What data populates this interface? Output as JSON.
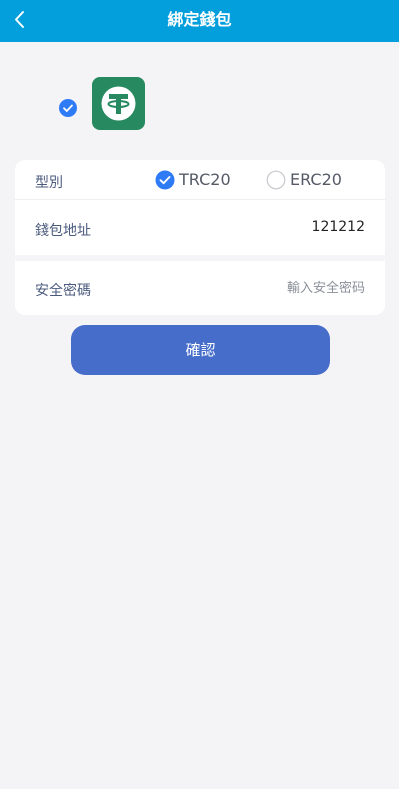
{
  "header": {
    "title": "綁定錢包",
    "back_icon": "chevron-left-icon",
    "background_color": "#039fdc"
  },
  "coin": {
    "selected": true,
    "logo_icon": "tether-usdt-icon",
    "logo_color": "#26895f"
  },
  "form": {
    "type": {
      "label": "型別",
      "options": [
        {
          "label": "TRC20",
          "selected": true
        },
        {
          "label": "ERC20",
          "selected": false
        }
      ]
    },
    "address": {
      "label": "錢包地址",
      "value": "121212"
    },
    "password": {
      "label": "安全密碼",
      "placeholder": "輸入安全密码",
      "value": ""
    }
  },
  "confirm_button": {
    "label": "確認",
    "color": "#456dc9"
  },
  "accent_color": "#2f7bf5"
}
